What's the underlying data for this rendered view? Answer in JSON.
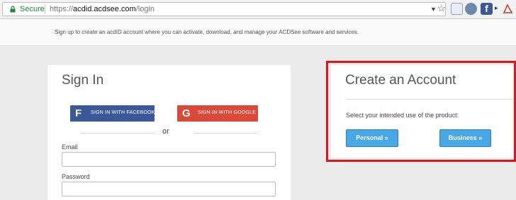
{
  "browser": {
    "secure_label": "Secure",
    "url_scheme": "https://",
    "url_host": "acdid.acdsee.com",
    "url_path": "/login"
  },
  "intro_text": "Sign up to create an acdID account where you can activate, download, and manage your ACDSee software and services.",
  "signin": {
    "title": "Sign In",
    "facebook_label": "SIGN IN WITH FACEBOOK",
    "google_label": "SIGN IN WITH GOOGLE",
    "or_text": "or",
    "email_label": "Email",
    "email_value": "",
    "password_label": "Password",
    "password_value": ""
  },
  "create_account": {
    "title": "Create an Account",
    "prompt": "Select your intended use of the product:",
    "personal_label": "Personal »",
    "business_label": "Business »"
  },
  "colors": {
    "facebook": "#3b5998",
    "google": "#db4a39",
    "action_blue": "#48a8e6",
    "highlight_red": "#e0141f"
  }
}
